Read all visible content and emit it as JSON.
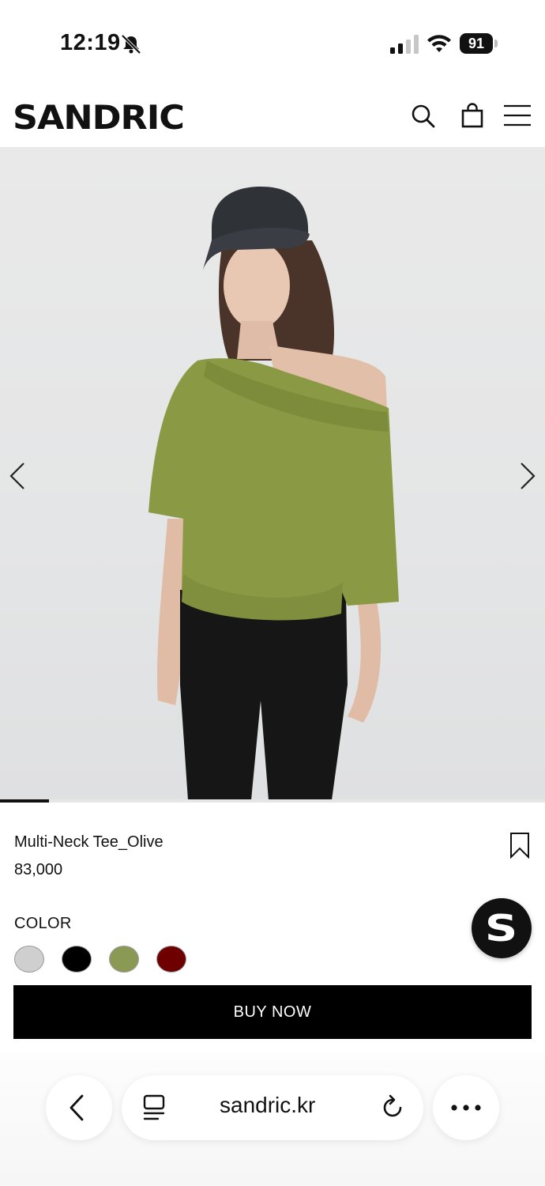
{
  "status_bar": {
    "time": "12:19",
    "battery": "91",
    "icons": [
      "bell-slash-icon",
      "cellular-signal-icon",
      "wifi-icon",
      "battery-icon"
    ]
  },
  "header": {
    "logo": "SANDRIC",
    "icons": [
      "search-icon",
      "shopping-bag-icon",
      "menu-icon"
    ]
  },
  "gallery": {
    "image_description_icon_names": [
      "chevron-left-icon",
      "chevron-right-icon"
    ],
    "progress_fraction": 0.09
  },
  "product": {
    "name": "Multi-Neck Tee_Olive",
    "price": "83,000",
    "color_label": "COLOR",
    "colors": [
      {
        "name": "light-gray",
        "hex": "#cfcfcf"
      },
      {
        "name": "black",
        "hex": "#000000"
      },
      {
        "name": "olive",
        "hex": "#8a9a55"
      },
      {
        "name": "burgundy",
        "hex": "#6e0000"
      }
    ],
    "buy_label": "BUY NOW"
  },
  "chat_button": {
    "letter": "S"
  },
  "browser": {
    "url": "sandric.kr",
    "icons": [
      "back-icon",
      "reader-icon",
      "reload-icon",
      "more-icon"
    ]
  }
}
